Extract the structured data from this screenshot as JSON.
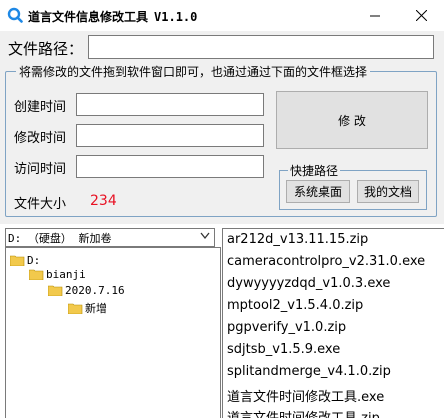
{
  "window": {
    "title": "道言文件信息修改工具",
    "version": "V1.1.0"
  },
  "path_row": {
    "label": "文件路径：",
    "value": ""
  },
  "group": {
    "legend": "将需修改的文件拖到软件窗口即可，也通过通过下面的文件框选择"
  },
  "fields": {
    "created_label": "创建时间",
    "created_value": "",
    "modified_label": "修改时间",
    "modified_value": "",
    "accessed_label": "访问时间",
    "accessed_value": "",
    "size_label": "文件大小",
    "size_value": "234"
  },
  "modify_button": "修 改",
  "quick_paths": {
    "legend": "快捷路径",
    "desktop_button": "系统桌面",
    "documents_button": "我的文档"
  },
  "drive_select": {
    "value": "D: （硬盘） 新加卷"
  },
  "tree": [
    "D:",
    "bianji",
    "2020.7.16",
    "新增"
  ],
  "files": [
    "ar212d_v13.11.15.zip",
    "cameracontrolpro_v2.31.0.exe",
    "dywyyyyzdqd_v1.0.3.exe",
    "mptool2_v1.5.4.0.zip",
    "pgpverify_v1.0.zip",
    "sdjtsb_v1.5.9.exe",
    "splitandmerge_v4.1.0.zip",
    "道言文件时间修改工具.exe",
    "道言文件时间修改工具.zip"
  ],
  "colors": {
    "accent": "#0078d7",
    "size_value": "#e81123",
    "panel": "#f0f0f0",
    "folder": "#f2c94c"
  },
  "icons": {
    "app": "magnifier-icon",
    "minimize": "minimize-icon",
    "close": "close-icon",
    "folder": "folder-icon",
    "dropdown": "chevron-down-icon"
  }
}
